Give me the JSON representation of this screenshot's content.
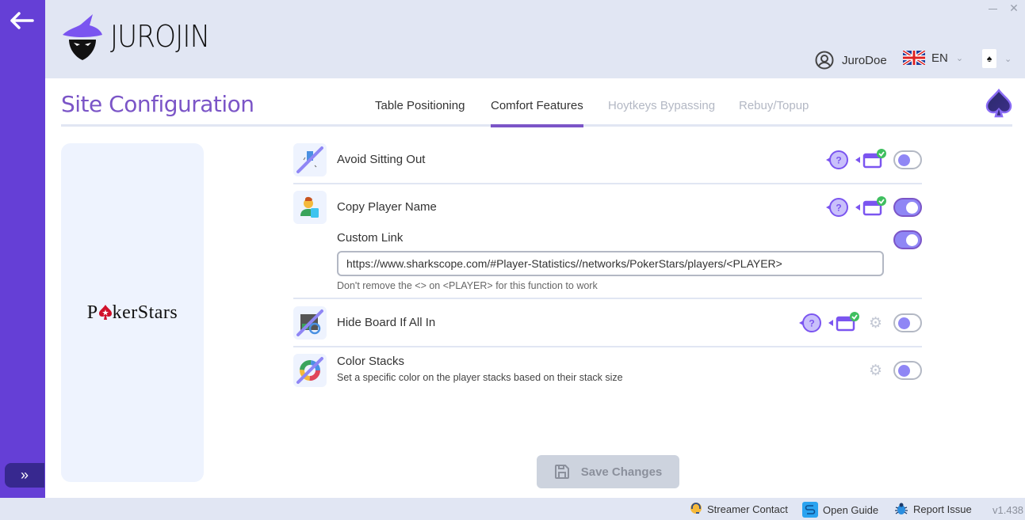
{
  "app": {
    "brand": "JUROJIN",
    "version": "v1.438"
  },
  "header": {
    "username": "JuroDoe",
    "language_code": "EN",
    "window_controls": {
      "minimize": "minimize-icon",
      "close": "close-icon"
    }
  },
  "page": {
    "title": "Site Configuration",
    "tabs": [
      {
        "label": "Table Positioning",
        "state": "normal"
      },
      {
        "label": "Comfort Features",
        "state": "active"
      },
      {
        "label": "Hoytkeys Bypassing",
        "state": "disabled"
      },
      {
        "label": "Rebuy/Topup",
        "state": "disabled"
      }
    ]
  },
  "site": {
    "name": "PokerStars",
    "logo_prefix": "P",
    "logo_suffix": "kerStars"
  },
  "features": [
    {
      "title": "Avoid Sitting Out",
      "description": "",
      "help": true,
      "window_indicator": true,
      "settings": false,
      "enabled": false
    },
    {
      "title": "Copy Player Name",
      "description": "",
      "help": true,
      "window_indicator": true,
      "settings": false,
      "enabled": true
    },
    {
      "title": "Hide Board If All In",
      "description": "",
      "help": true,
      "window_indicator": true,
      "settings": true,
      "enabled": false
    },
    {
      "title": "Color Stacks",
      "description": "Set a specific color on the player stacks based on their stack size",
      "help": false,
      "window_indicator": false,
      "settings": true,
      "enabled": false
    }
  ],
  "custom_link": {
    "label": "Custom Link",
    "enabled": true,
    "value": "https://www.sharkscope.com/#Player-Statistics//networks/PokerStars/players/<PLAYER>",
    "hint": "Don't remove the <> on <PLAYER> for this function to work"
  },
  "actions": {
    "save_label": "Save Changes",
    "save_enabled": false
  },
  "footer": {
    "items": [
      {
        "label": "Streamer Contact",
        "icon": "headset-icon"
      },
      {
        "label": "Open Guide",
        "icon": "guide-icon"
      },
      {
        "label": "Report Issue",
        "icon": "bug-icon"
      }
    ]
  },
  "colors": {
    "sidebar": "#653fd6",
    "accent": "#7b55c7",
    "toggle": "#8f86f5",
    "background": "#e1e6f3"
  }
}
